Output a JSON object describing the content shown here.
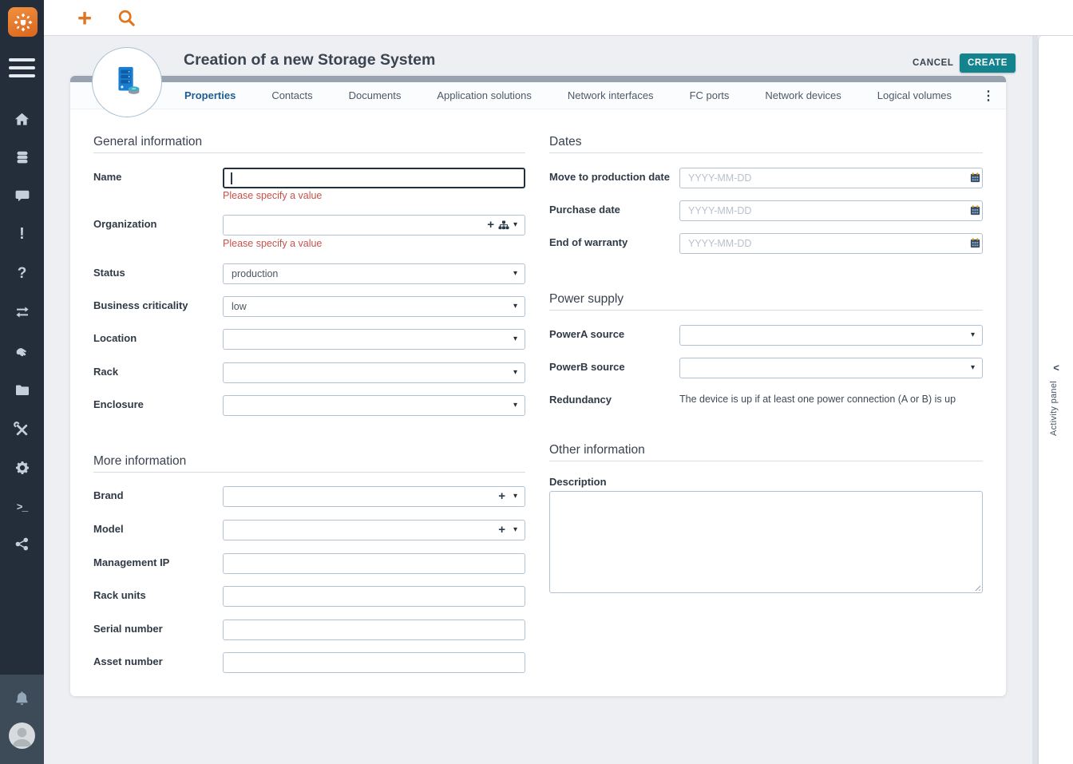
{
  "app": {
    "name": "iTop"
  },
  "colors": {
    "accent_orange": "#e0761f",
    "create_teal": "#13838e",
    "error_red": "#c4534d",
    "sidebar_dark": "#232e3a",
    "active_tab_blue": "#1d5d94"
  },
  "sidebar": {
    "items": [
      {
        "icon": "home-icon"
      },
      {
        "icon": "database-icon"
      },
      {
        "icon": "chat-icon"
      },
      {
        "icon": "exclamation-icon",
        "glyph": "!"
      },
      {
        "icon": "question-icon",
        "glyph": "?"
      },
      {
        "icon": "exchange-arrows-icon"
      },
      {
        "icon": "handshake-icon"
      },
      {
        "icon": "folder-icon"
      },
      {
        "icon": "tools-icon"
      },
      {
        "icon": "gear-icon"
      },
      {
        "icon": "terminal-icon",
        "glyph": ">_"
      },
      {
        "icon": "share-icon"
      }
    ],
    "bottom": [
      {
        "icon": "bell-icon"
      },
      {
        "icon": "user-avatar"
      }
    ]
  },
  "topbar": {
    "actions": [
      {
        "icon": "plus-icon",
        "glyph": "+"
      },
      {
        "icon": "search-icon"
      }
    ]
  },
  "header": {
    "title": "Creation of a new Storage System",
    "cancel_label": "CANCEL",
    "create_label": "CREATE"
  },
  "tabs": {
    "items": [
      "Properties",
      "Contacts",
      "Documents",
      "Application solutions",
      "Network interfaces",
      "FC ports",
      "Network devices",
      "Logical volumes"
    ],
    "active": "Properties",
    "overflow_icon": "kebab-menu-icon"
  },
  "form": {
    "general": {
      "title": "General information",
      "fields": [
        {
          "label": "Name",
          "type": "text",
          "value": "",
          "error": "Please specify a value",
          "focused": true
        },
        {
          "label": "Organization",
          "type": "autocomplete",
          "value": "",
          "error": "Please specify a value",
          "icons": [
            "plus-icon",
            "sitemap-icon",
            "caret-down-icon"
          ]
        },
        {
          "label": "Status",
          "type": "select",
          "value": "production"
        },
        {
          "label": "Business criticality",
          "type": "select",
          "value": "low"
        },
        {
          "label": "Location",
          "type": "select",
          "value": ""
        },
        {
          "label": "Rack",
          "type": "select",
          "value": ""
        },
        {
          "label": "Enclosure",
          "type": "select",
          "value": ""
        }
      ]
    },
    "more": {
      "title": "More information",
      "fields": [
        {
          "label": "Brand",
          "type": "extensible-select",
          "value": "",
          "icons": [
            "plus-icon",
            "caret-down-icon"
          ]
        },
        {
          "label": "Model",
          "type": "extensible-select",
          "value": "",
          "icons": [
            "plus-icon",
            "caret-down-icon"
          ]
        },
        {
          "label": "Management IP",
          "type": "text",
          "value": ""
        },
        {
          "label": "Rack units",
          "type": "text",
          "value": ""
        },
        {
          "label": "Serial number",
          "type": "text",
          "value": ""
        },
        {
          "label": "Asset number",
          "type": "text",
          "value": ""
        }
      ]
    },
    "dates": {
      "title": "Dates",
      "fields": [
        {
          "label": "Move to production date",
          "type": "date",
          "value": "",
          "placeholder": "YYYY-MM-DD",
          "icon": "calendar-icon"
        },
        {
          "label": "Purchase date",
          "type": "date",
          "value": "",
          "placeholder": "YYYY-MM-DD",
          "icon": "calendar-icon"
        },
        {
          "label": "End of warranty",
          "type": "date",
          "value": "",
          "placeholder": "YYYY-MM-DD",
          "icon": "calendar-icon"
        }
      ]
    },
    "power": {
      "title": "Power supply",
      "fields": [
        {
          "label": "PowerA source",
          "type": "select",
          "value": ""
        },
        {
          "label": "PowerB source",
          "type": "select",
          "value": ""
        }
      ],
      "redundancy": {
        "label": "Redundancy",
        "text": "The device is up if at least one power connection (A or B) is up"
      }
    },
    "other": {
      "title": "Other information",
      "description_label": "Description",
      "description_value": ""
    }
  },
  "activity_panel": {
    "label": "Activity panel",
    "collapse_icon": "chevron-left-icon"
  }
}
